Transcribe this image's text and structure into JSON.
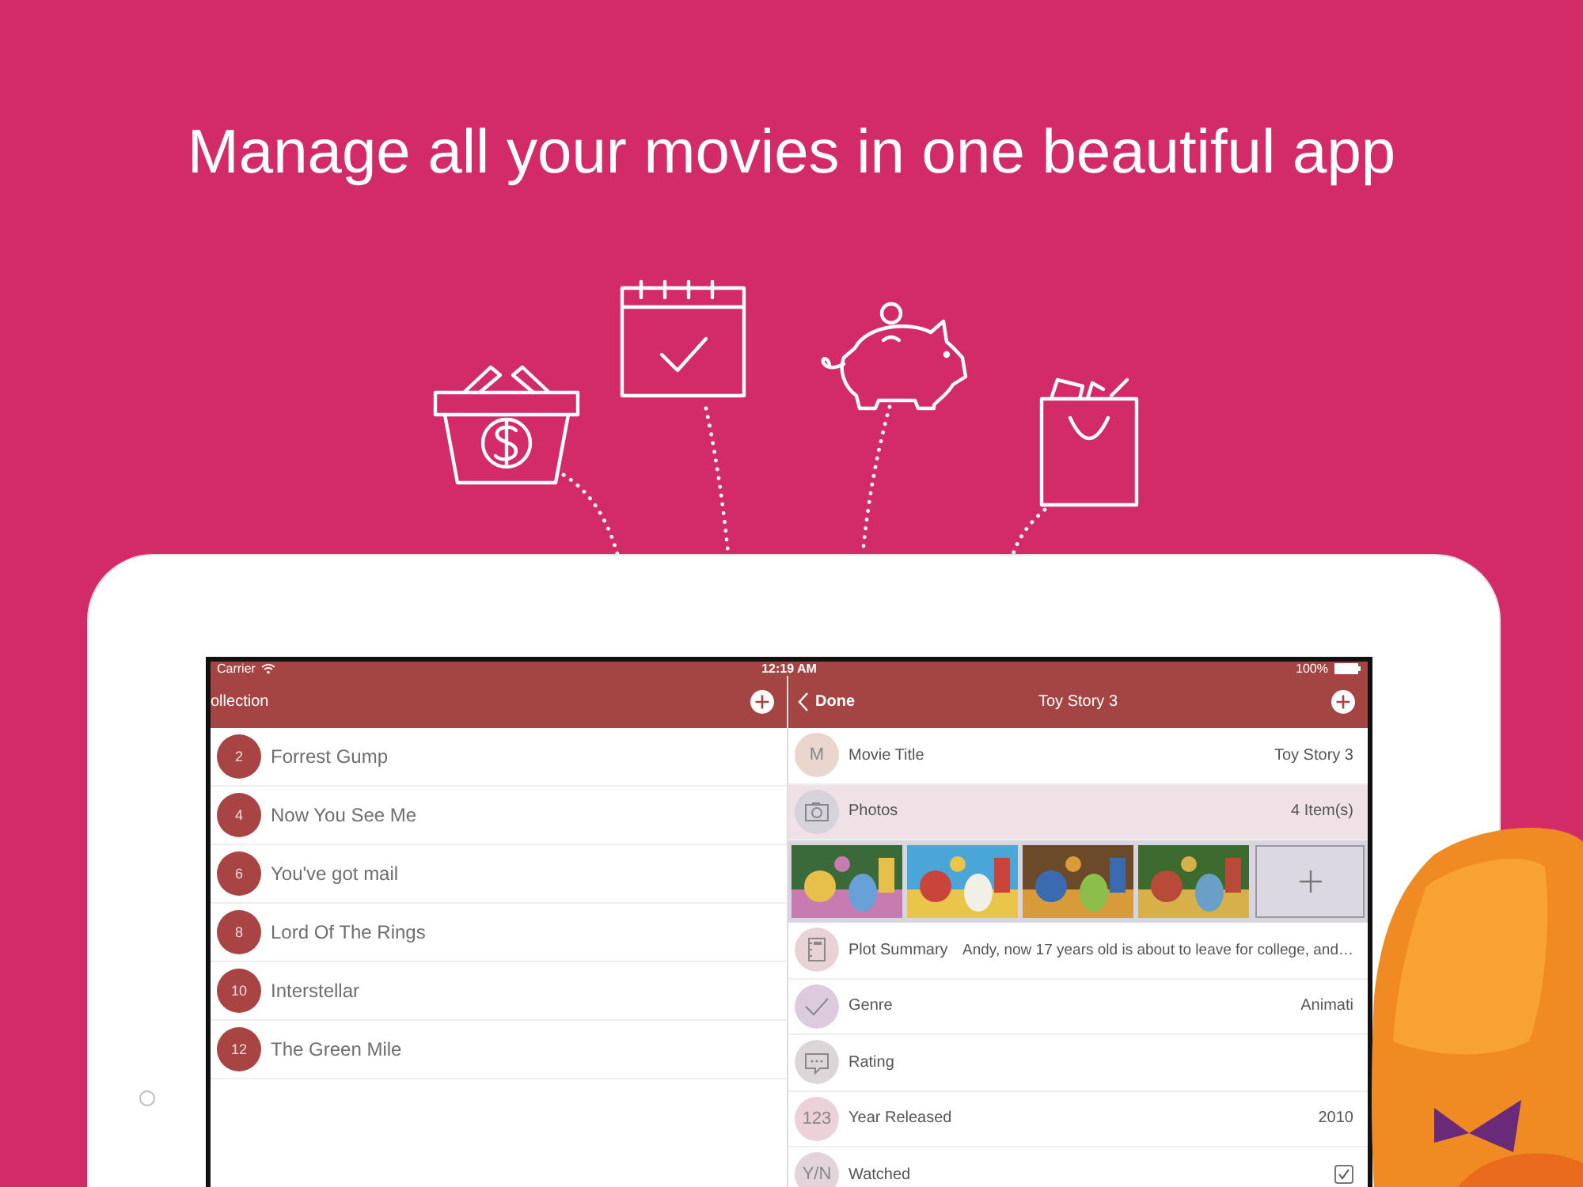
{
  "headline": "Manage all your movies in one beautiful app",
  "status_bar": {
    "carrier": "Carrier",
    "time": "12:19 AM",
    "battery": "100%"
  },
  "master": {
    "title": "ollection",
    "items": [
      {
        "number": "2",
        "title": "Forrest Gump"
      },
      {
        "number": "4",
        "title": "Now You See Me"
      },
      {
        "number": "6",
        "title": "You've got mail"
      },
      {
        "number": "8",
        "title": "Lord Of The Rings"
      },
      {
        "number": "10",
        "title": "Interstellar"
      },
      {
        "number": "12",
        "title": "The Green Mile"
      }
    ]
  },
  "detail": {
    "back": "Done",
    "title": "Toy Story 3",
    "fields": [
      {
        "kind": "badge",
        "badge": "M",
        "color": "#ead6cf",
        "label": "Movie Title",
        "value": "Toy Story 3",
        "selected": false
      },
      {
        "kind": "photos",
        "color": "#d6d3dc",
        "label": "Photos",
        "value": "4 Item(s)",
        "selected": true
      },
      {
        "kind": "gallery"
      },
      {
        "kind": "summary",
        "color": "#e8d2d6",
        "label": "Plot Summary",
        "value": "Andy, now 17 years old is about to leave for college, and…",
        "selected": false
      },
      {
        "kind": "genre",
        "color": "#dccbdc",
        "label": "Genre",
        "value": "Animati",
        "selected": false
      },
      {
        "kind": "rating",
        "color": "#ddd6d8",
        "label": "Rating",
        "selected": false
      },
      {
        "kind": "badge",
        "badge": "123",
        "color": "#ecd1d9",
        "label": "Year Released",
        "value": "2010",
        "selected": false
      },
      {
        "kind": "check",
        "badge": "Y/N",
        "color": "#e3d3da",
        "label": "Watched",
        "checked": true,
        "selected": false
      }
    ]
  }
}
